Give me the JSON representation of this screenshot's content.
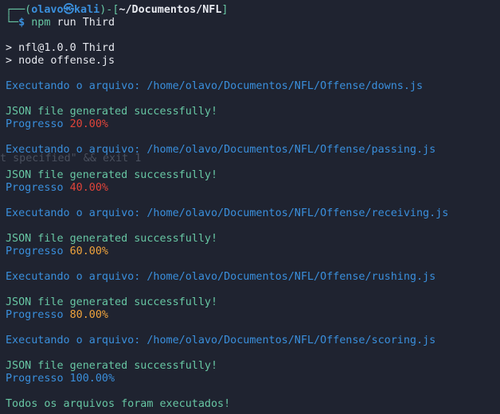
{
  "prompt": {
    "corner_top": "┌──(",
    "user": "olavo",
    "at_symbol": "㉿",
    "host": "kali",
    "bracket_mid": ")-[",
    "path": "~/Documentos/NFL",
    "bracket_end": "]",
    "corner_bottom": "└─",
    "dollar": "$",
    "command_bin": "npm",
    "command_args": " run Third"
  },
  "npm_header": [
    "> nfl@1.0.0 Third",
    "> node offense.js"
  ],
  "ghost_text": "t specified\" && exit 1",
  "executing_prefix": "Executando o arquivo: ",
  "success_text": "JSON file generated successfully!",
  "progress_label": "Progresso ",
  "runs": [
    {
      "file": "/home/olavo/Documentos/NFL/Offense/downs.js",
      "progress": "20.00%",
      "color": "#e0443a"
    },
    {
      "file": "/home/olavo/Documentos/NFL/Offense/passing.js",
      "progress": "40.00%",
      "color": "#e0443a"
    },
    {
      "file": "/home/olavo/Documentos/NFL/Offense/receiving.js",
      "progress": "60.00%",
      "color": "#f0a33c"
    },
    {
      "file": "/home/olavo/Documentos/NFL/Offense/rushing.js",
      "progress": "80.00%",
      "color": "#f0a33c"
    },
    {
      "file": "/home/olavo/Documentos/NFL/Offense/scoring.js",
      "progress": "100.00%",
      "color": "#3a8fdc"
    }
  ],
  "final_message": "Todos os arquivos foram executados!"
}
